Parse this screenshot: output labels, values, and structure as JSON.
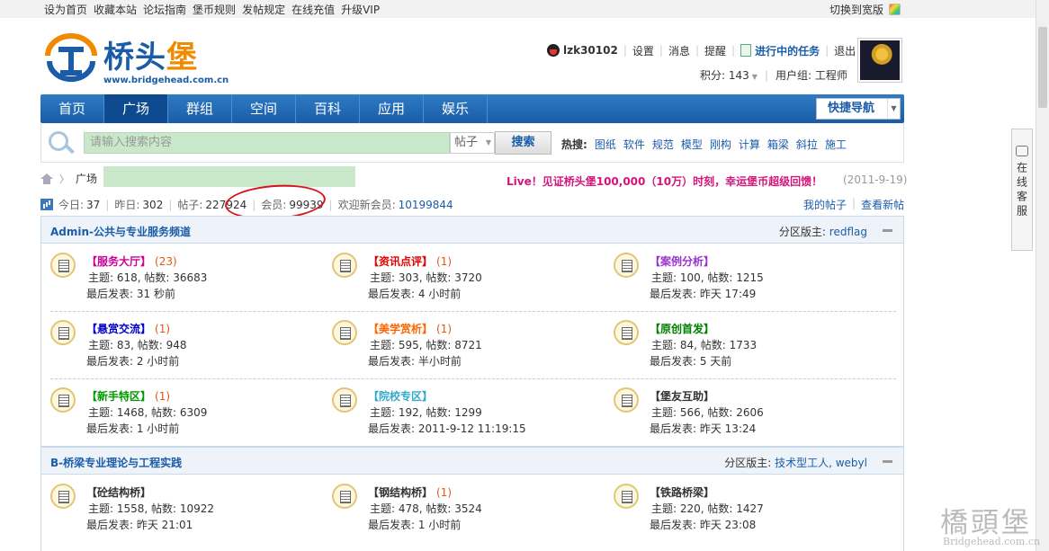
{
  "topbar": {
    "links": [
      "设为首页",
      "收藏本站",
      "论坛指南",
      "堡币规则",
      "发帖规定",
      "在线充值",
      "升级VIP"
    ],
    "wide": "切换到宽版"
  },
  "logo": {
    "name_a": "桥头",
    "name_b": "堡",
    "url": "www.bridgehead.com.cn"
  },
  "user": {
    "name": "lzk30102",
    "links": [
      "设置",
      "消息",
      "提醒"
    ],
    "task": "进行中的任务",
    "logout": "退出",
    "score": "积分: 143",
    "group": "用户组: 工程师"
  },
  "nav": {
    "items": [
      "首页",
      "广场",
      "群组",
      "空间",
      "百科",
      "应用",
      "娱乐"
    ],
    "active": "广场",
    "quick": "快捷导航"
  },
  "search": {
    "placeholder": "请输入搜索内容",
    "type": "帖子",
    "button": "搜索",
    "hot_label": "热搜:",
    "hot": [
      "图纸",
      "软件",
      "规范",
      "模型",
      "刚构",
      "计算",
      "箱梁",
      "斜拉",
      "施工"
    ]
  },
  "breadcrumb": {
    "current": "广场"
  },
  "notice": {
    "text": "Live！见证桥头堡100,000（10万）时刻，幸运堡币超级回馈！",
    "date": "(2011-9-19)"
  },
  "stats": {
    "today_label": "今日:",
    "today": "37",
    "yesterday_label": "昨日:",
    "yesterday": "302",
    "posts_label": "帖子:",
    "posts": "227924",
    "members_label": "会员:",
    "members": "99939",
    "welcome_label": "欢迎新会员:",
    "welcome": "10199844",
    "my_posts": "我的帖子",
    "new_posts": "查看新帖"
  },
  "sections": [
    {
      "title": "Admin-公共与专业服务频道",
      "mod_label": "分区版主:",
      "mods": "redflag",
      "forums": [
        {
          "name": "【服务大厅】",
          "color": "#cc0099",
          "count": "(23)",
          "line1": "主题: 618, 帖数: 36683",
          "line2": "最后发表: 31 秒前"
        },
        {
          "name": "【资讯点评】",
          "color": "#e60000",
          "count": "(1)",
          "line1": "主题: 303, 帖数: 3720",
          "line2": "最后发表: 4 小时前"
        },
        {
          "name": "【案例分析】",
          "color": "#9933cc",
          "count": "",
          "line1": "主题: 100, 帖数: 1215",
          "line2": "最后发表: 昨天 17:49"
        },
        {
          "name": "【悬赏交流】",
          "color": "#0000cc",
          "count": "(1)",
          "line1": "主题: 83, 帖数: 948",
          "line2": "最后发表: 2 小时前"
        },
        {
          "name": "【美学赏析】",
          "color": "#ff6600",
          "count": "(1)",
          "line1": "主题: 595, 帖数: 8721",
          "line2": "最后发表: 半小时前"
        },
        {
          "name": "【原创首发】",
          "color": "#008000",
          "count": "",
          "line1": "主题: 84, 帖数: 1733",
          "line2": "最后发表: 5 天前"
        },
        {
          "name": "【新手特区】",
          "color": "#009900",
          "count": "(1)",
          "line1": "主题: 1468, 帖数: 6309",
          "line2": "最后发表: 1 小时前"
        },
        {
          "name": "【院校专区】",
          "color": "#33aacc",
          "count": "",
          "line1": "主题: 192, 帖数: 1299",
          "line2": "最后发表: 2011-9-12 11:19:15"
        },
        {
          "name": "【堡友互助】",
          "color": "#333333",
          "count": "",
          "line1": "主题: 566, 帖数: 2606",
          "line2": "最后发表: 昨天 13:24"
        }
      ]
    },
    {
      "title": "B-桥梁专业理论与工程实践",
      "mod_label": "分区版主:",
      "mods": "技术型工人, webyl",
      "forums": [
        {
          "name": "【砼结构桥】",
          "color": "#333333",
          "count": "",
          "line1": "主题: 1558, 帖数: 10922",
          "line2": "最后发表: 昨天 21:01"
        },
        {
          "name": "【钢结构桥】",
          "color": "#333333",
          "count": "(1)",
          "line1": "主题: 478, 帖数: 3524",
          "line2": "最后发表: 1 小时前"
        },
        {
          "name": "【铁路桥梁】",
          "color": "#333333",
          "count": "",
          "line1": "主题: 220, 帖数: 1427",
          "line2": "最后发表: 昨天 23:08"
        }
      ]
    }
  ],
  "service": {
    "text": "在线客服"
  },
  "watermark": {
    "text": "橋頭堡",
    "url": "Bridgehead.com.cn"
  }
}
